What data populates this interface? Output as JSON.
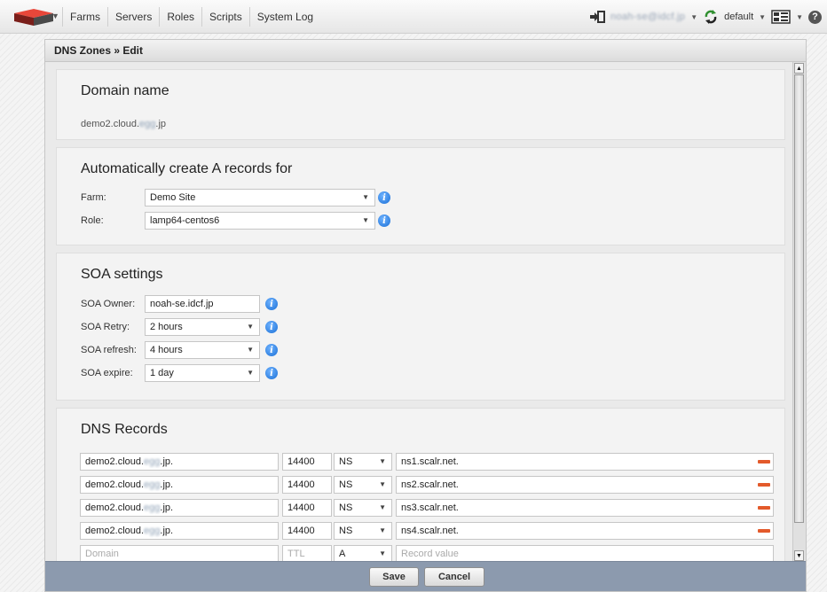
{
  "nav": {
    "items": [
      "Farms",
      "Servers",
      "Roles",
      "Scripts",
      "System Log"
    ]
  },
  "header_right": {
    "user_email": "noah-se@idcf.jp",
    "environment": "default"
  },
  "icons": {
    "logo": "scalr-logo",
    "login": "login-arrow-icon",
    "environment": "environment-cycle-icon",
    "grid": "dashboard-grid-icon",
    "help": "help-icon",
    "info": "info-icon",
    "remove": "remove-icon"
  },
  "colors": {
    "info_blue": "#1a6fd6",
    "remove_orange": "#e35a2b",
    "footer_bar": "#8c9aae"
  },
  "panel": {
    "title": "DNS Zones » Edit"
  },
  "domain": {
    "title": "Domain name",
    "name_prefix": "demo2.cloud.",
    "name_hidden": "egg",
    "name_suffix": ".jp"
  },
  "auto_a": {
    "title": "Automatically create A records for",
    "farm_label": "Farm:",
    "farm_value": "Demo Site",
    "role_label": "Role:",
    "role_value": "lamp64-centos6"
  },
  "soa": {
    "title": "SOA settings",
    "owner_label": "SOA Owner:",
    "owner_value": "noah-se.idcf.jp",
    "retry_label": "SOA Retry:",
    "retry_value": "2 hours",
    "refresh_label": "SOA refresh:",
    "refresh_value": "4 hours",
    "expire_label": "SOA expire:",
    "expire_value": "1 day"
  },
  "dns": {
    "title": "DNS Records",
    "records": [
      {
        "domain_prefix": "demo2.cloud.",
        "domain_hidden": "egg",
        "domain_suffix": ".jp.",
        "ttl": "14400",
        "type": "NS",
        "value": "ns1.scalr.net."
      },
      {
        "domain_prefix": "demo2.cloud.",
        "domain_hidden": "egg",
        "domain_suffix": ".jp.",
        "ttl": "14400",
        "type": "NS",
        "value": "ns2.scalr.net."
      },
      {
        "domain_prefix": "demo2.cloud.",
        "domain_hidden": "egg",
        "domain_suffix": ".jp.",
        "ttl": "14400",
        "type": "NS",
        "value": "ns3.scalr.net."
      },
      {
        "domain_prefix": "demo2.cloud.",
        "domain_hidden": "egg",
        "domain_suffix": ".jp.",
        "ttl": "14400",
        "type": "NS",
        "value": "ns4.scalr.net."
      }
    ],
    "new_record": {
      "domain_placeholder": "Domain",
      "ttl_placeholder": "TTL",
      "type": "A",
      "value_placeholder": "Record value"
    }
  },
  "footer": {
    "save_label": "Save",
    "cancel_label": "Cancel"
  }
}
